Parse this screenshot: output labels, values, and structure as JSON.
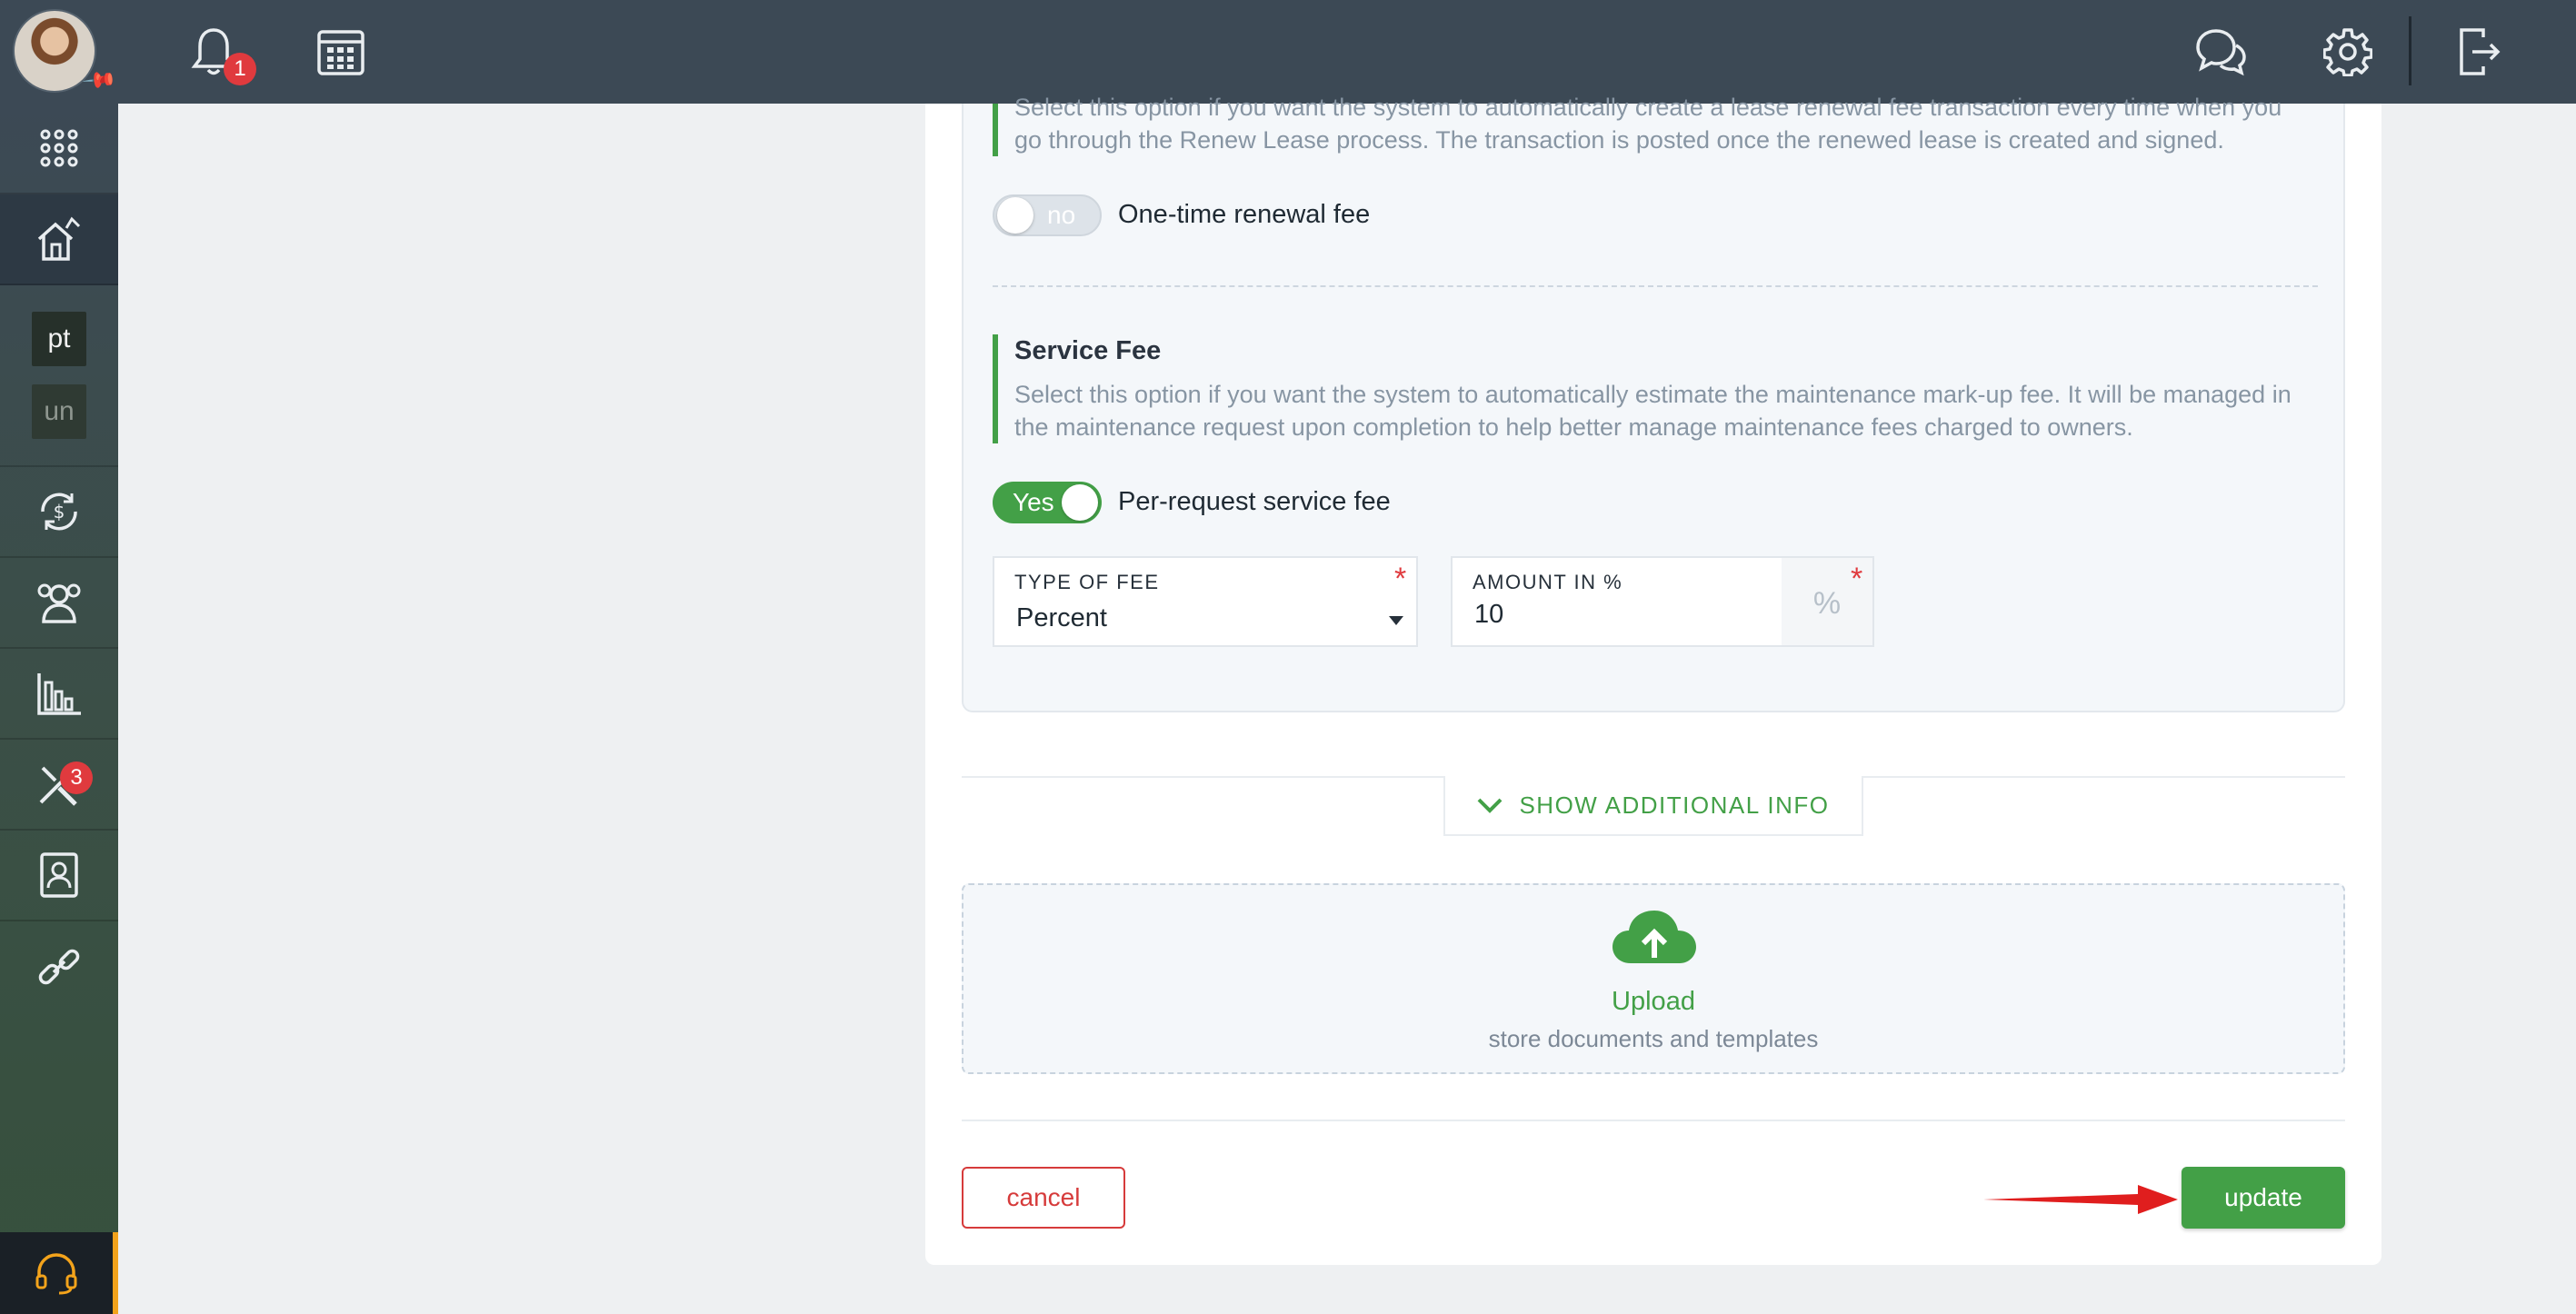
{
  "header": {
    "notifications_badge": "1",
    "icons": [
      "bell-icon",
      "calendar-icon",
      "chat-icon",
      "gear-icon",
      "logout-icon"
    ]
  },
  "sidebar": {
    "items": [
      {
        "name": "apps-grid-icon"
      },
      {
        "name": "properties-icon"
      },
      {
        "label": "pt"
      },
      {
        "label": "un"
      },
      {
        "name": "accounting-icon"
      },
      {
        "name": "people-icon"
      },
      {
        "name": "reports-icon"
      },
      {
        "name": "maintenance-icon",
        "badge": "3"
      },
      {
        "name": "documents-icon"
      },
      {
        "name": "integrations-icon"
      }
    ],
    "support_icon": "headset-icon"
  },
  "renewal": {
    "description": "Select this option if you want the system to automatically create a lease renewal fee transaction every time when you go through the Renew Lease process. The transaction is posted once the renewed lease is created and signed.",
    "toggle_state": "no",
    "toggle_label": "One-time renewal fee"
  },
  "service_fee": {
    "title": "Service Fee",
    "description": "Select this option if you want the system to automatically estimate the maintenance mark-up fee. It will be managed in the maintenance request upon completion to help better manage maintenance fees charged to owners.",
    "toggle_state": "Yes",
    "toggle_label": "Per-request service fee",
    "type_of_fee": {
      "label": "TYPE OF FEE",
      "value": "Percent"
    },
    "amount": {
      "label": "AMOUNT IN %",
      "value": "10",
      "unit": "%"
    }
  },
  "show_additional_info": "SHOW ADDITIONAL INFO",
  "upload": {
    "title": "Upload",
    "subtitle": "store documents and templates"
  },
  "actions": {
    "cancel": "cancel",
    "update": "update"
  },
  "colors": {
    "topbar": "#3c4955",
    "accent_green": "#43a047",
    "danger_red": "#d63b3b",
    "support_orange": "#f3a31b"
  }
}
